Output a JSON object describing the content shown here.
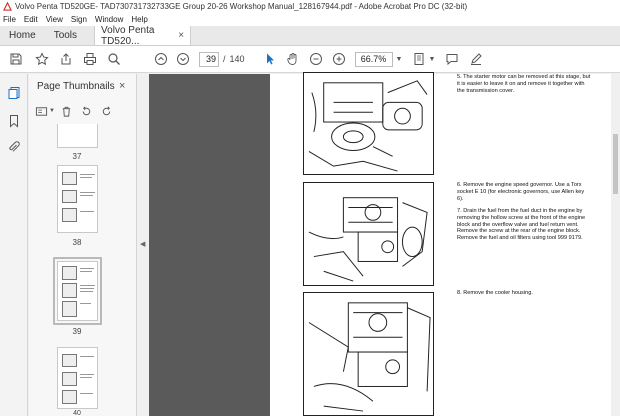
{
  "window": {
    "title": "Volvo Penta TD520GE- TAD730731732733GE Group 20-26 Workshop Manual_128167944.pdf - Adobe Acrobat Pro DC (32-bit)"
  },
  "menu": [
    "File",
    "Edit",
    "View",
    "Sign",
    "Window",
    "Help"
  ],
  "tabs": {
    "home": "Home",
    "tools": "Tools",
    "document": "Volvo Penta TD520...",
    "close": "×"
  },
  "toolbar": {
    "current_page": "39",
    "page_separator": "/",
    "total_pages": "140",
    "zoom": "66.7%"
  },
  "thumbnails": {
    "title": "Page Thumbnails",
    "close": "×",
    "pages": [
      {
        "label": "37"
      },
      {
        "label": "38"
      },
      {
        "label": "39",
        "selected": true
      },
      {
        "label": "40"
      }
    ]
  },
  "document": {
    "steps": [
      {
        "text": "5. The starter motor can be removed at this stage, but it is easier to leave it on and remove it together with the transmission cover."
      },
      {
        "text": "6. Remove the engine speed governor. Use a Torx socket E 10 (for electronic governors, use Allen key 6)."
      },
      {
        "text": "7. Drain the fuel from the fuel duct in the engine by removing the hollow screw at the front of the engine block and the overflow valve and fuel return vent. Remove the screw at the rear of the engine block. Remove the fuel and oil filters using tool 999 9179."
      },
      {
        "text": "8. Remove the cooler housing."
      }
    ]
  },
  "colors": {
    "accent_blue": "#1a73c8",
    "acrobat_red": "#d32f2f",
    "doc_background": "#5a5a5a"
  }
}
